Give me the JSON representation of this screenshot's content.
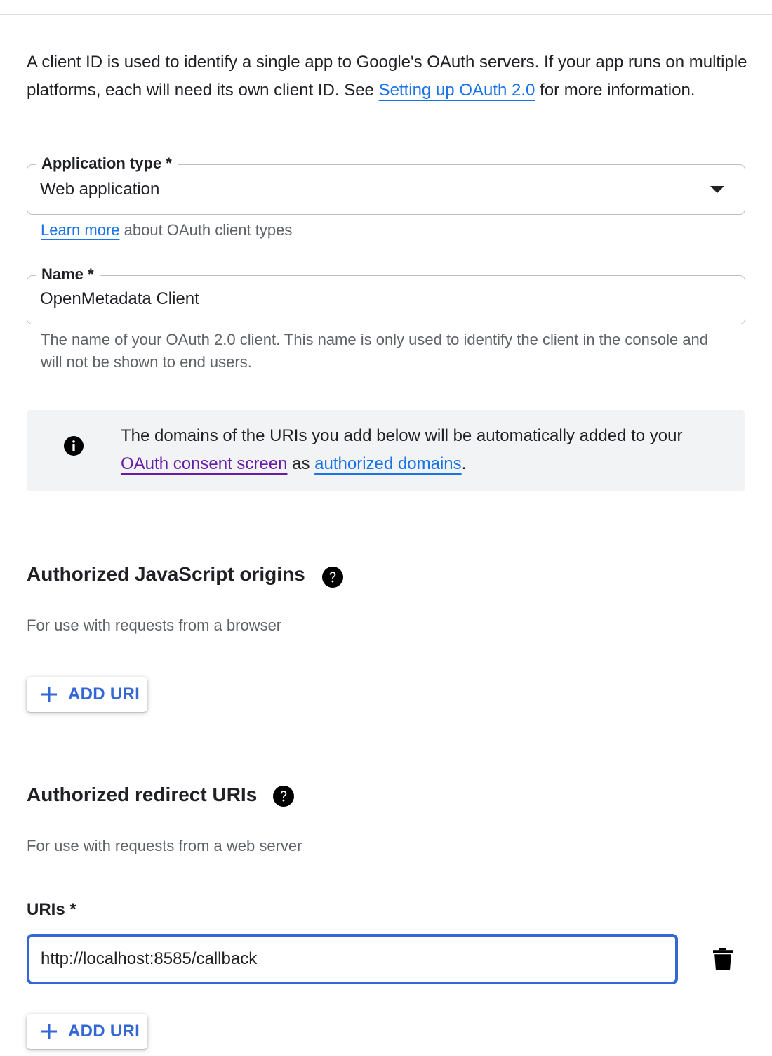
{
  "intro": {
    "text_before": "A client ID is used to identify a single app to Google's OAuth servers. If your app runs on multiple platforms, each will need its own client ID. See ",
    "link": "Setting up OAuth 2.0",
    "text_after": " for more information."
  },
  "application_type": {
    "label": "Application type *",
    "value": "Web application",
    "hint_link": "Learn more",
    "hint_text": " about OAuth client types"
  },
  "name_field": {
    "label": "Name *",
    "value": "OpenMetadata Client",
    "hint": "The name of your OAuth 2.0 client. This name is only used to identify the client in the console and will not be shown to end users."
  },
  "info_banner": {
    "text_before": "The domains of the URIs you add below will be automatically added to your ",
    "link_consent": "OAuth consent screen",
    "text_middle": " as ",
    "link_domains": "authorized domains",
    "text_after": "."
  },
  "js_origins": {
    "title": "Authorized JavaScript origins",
    "subtitle": "For use with requests from a browser",
    "add_button": "ADD URI"
  },
  "redirect_uris": {
    "title": "Authorized redirect URIs",
    "subtitle": "For use with requests from a web server",
    "uris_label": "URIs *",
    "uri_value": "http://localhost:8585/callback",
    "add_button": "ADD URI"
  },
  "colors": {
    "link": "#1a73e8",
    "visited_link": "#681da8",
    "button_text": "#3367d6",
    "focus_border": "#3367d6"
  },
  "icons": {
    "info": "info-icon",
    "help": "help-icon",
    "add": "plus-icon",
    "delete": "trash-icon",
    "dropdown": "caret-down-icon"
  }
}
